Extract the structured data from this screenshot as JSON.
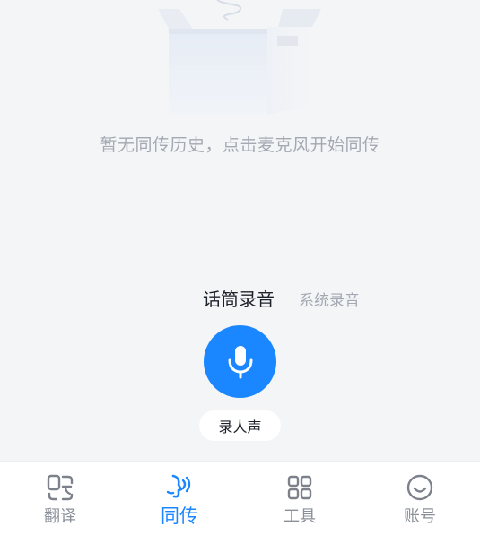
{
  "empty_state": {
    "message": "暂无同传历史，点击麦克风开始同传",
    "icon": "empty-box-illustration"
  },
  "mode_tabs": {
    "mic": "话筒录音",
    "system": "系统录音",
    "selected": "mic"
  },
  "mic_button": {
    "icon": "microphone-icon"
  },
  "record_pill": {
    "label": "录人声"
  },
  "bottom_nav": {
    "items": [
      {
        "label": "翻译",
        "icon": "translate-icon",
        "active": false
      },
      {
        "label": "同传",
        "icon": "interpret-icon",
        "active": true
      },
      {
        "label": "工具",
        "icon": "grid-icon",
        "active": false
      },
      {
        "label": "账号",
        "icon": "smile-icon",
        "active": false
      }
    ]
  },
  "colors": {
    "accent": "#1a86ff",
    "background": "#f4f5f7",
    "muted_text": "#a3a8b2",
    "nav_inactive": "#8a8f99"
  }
}
